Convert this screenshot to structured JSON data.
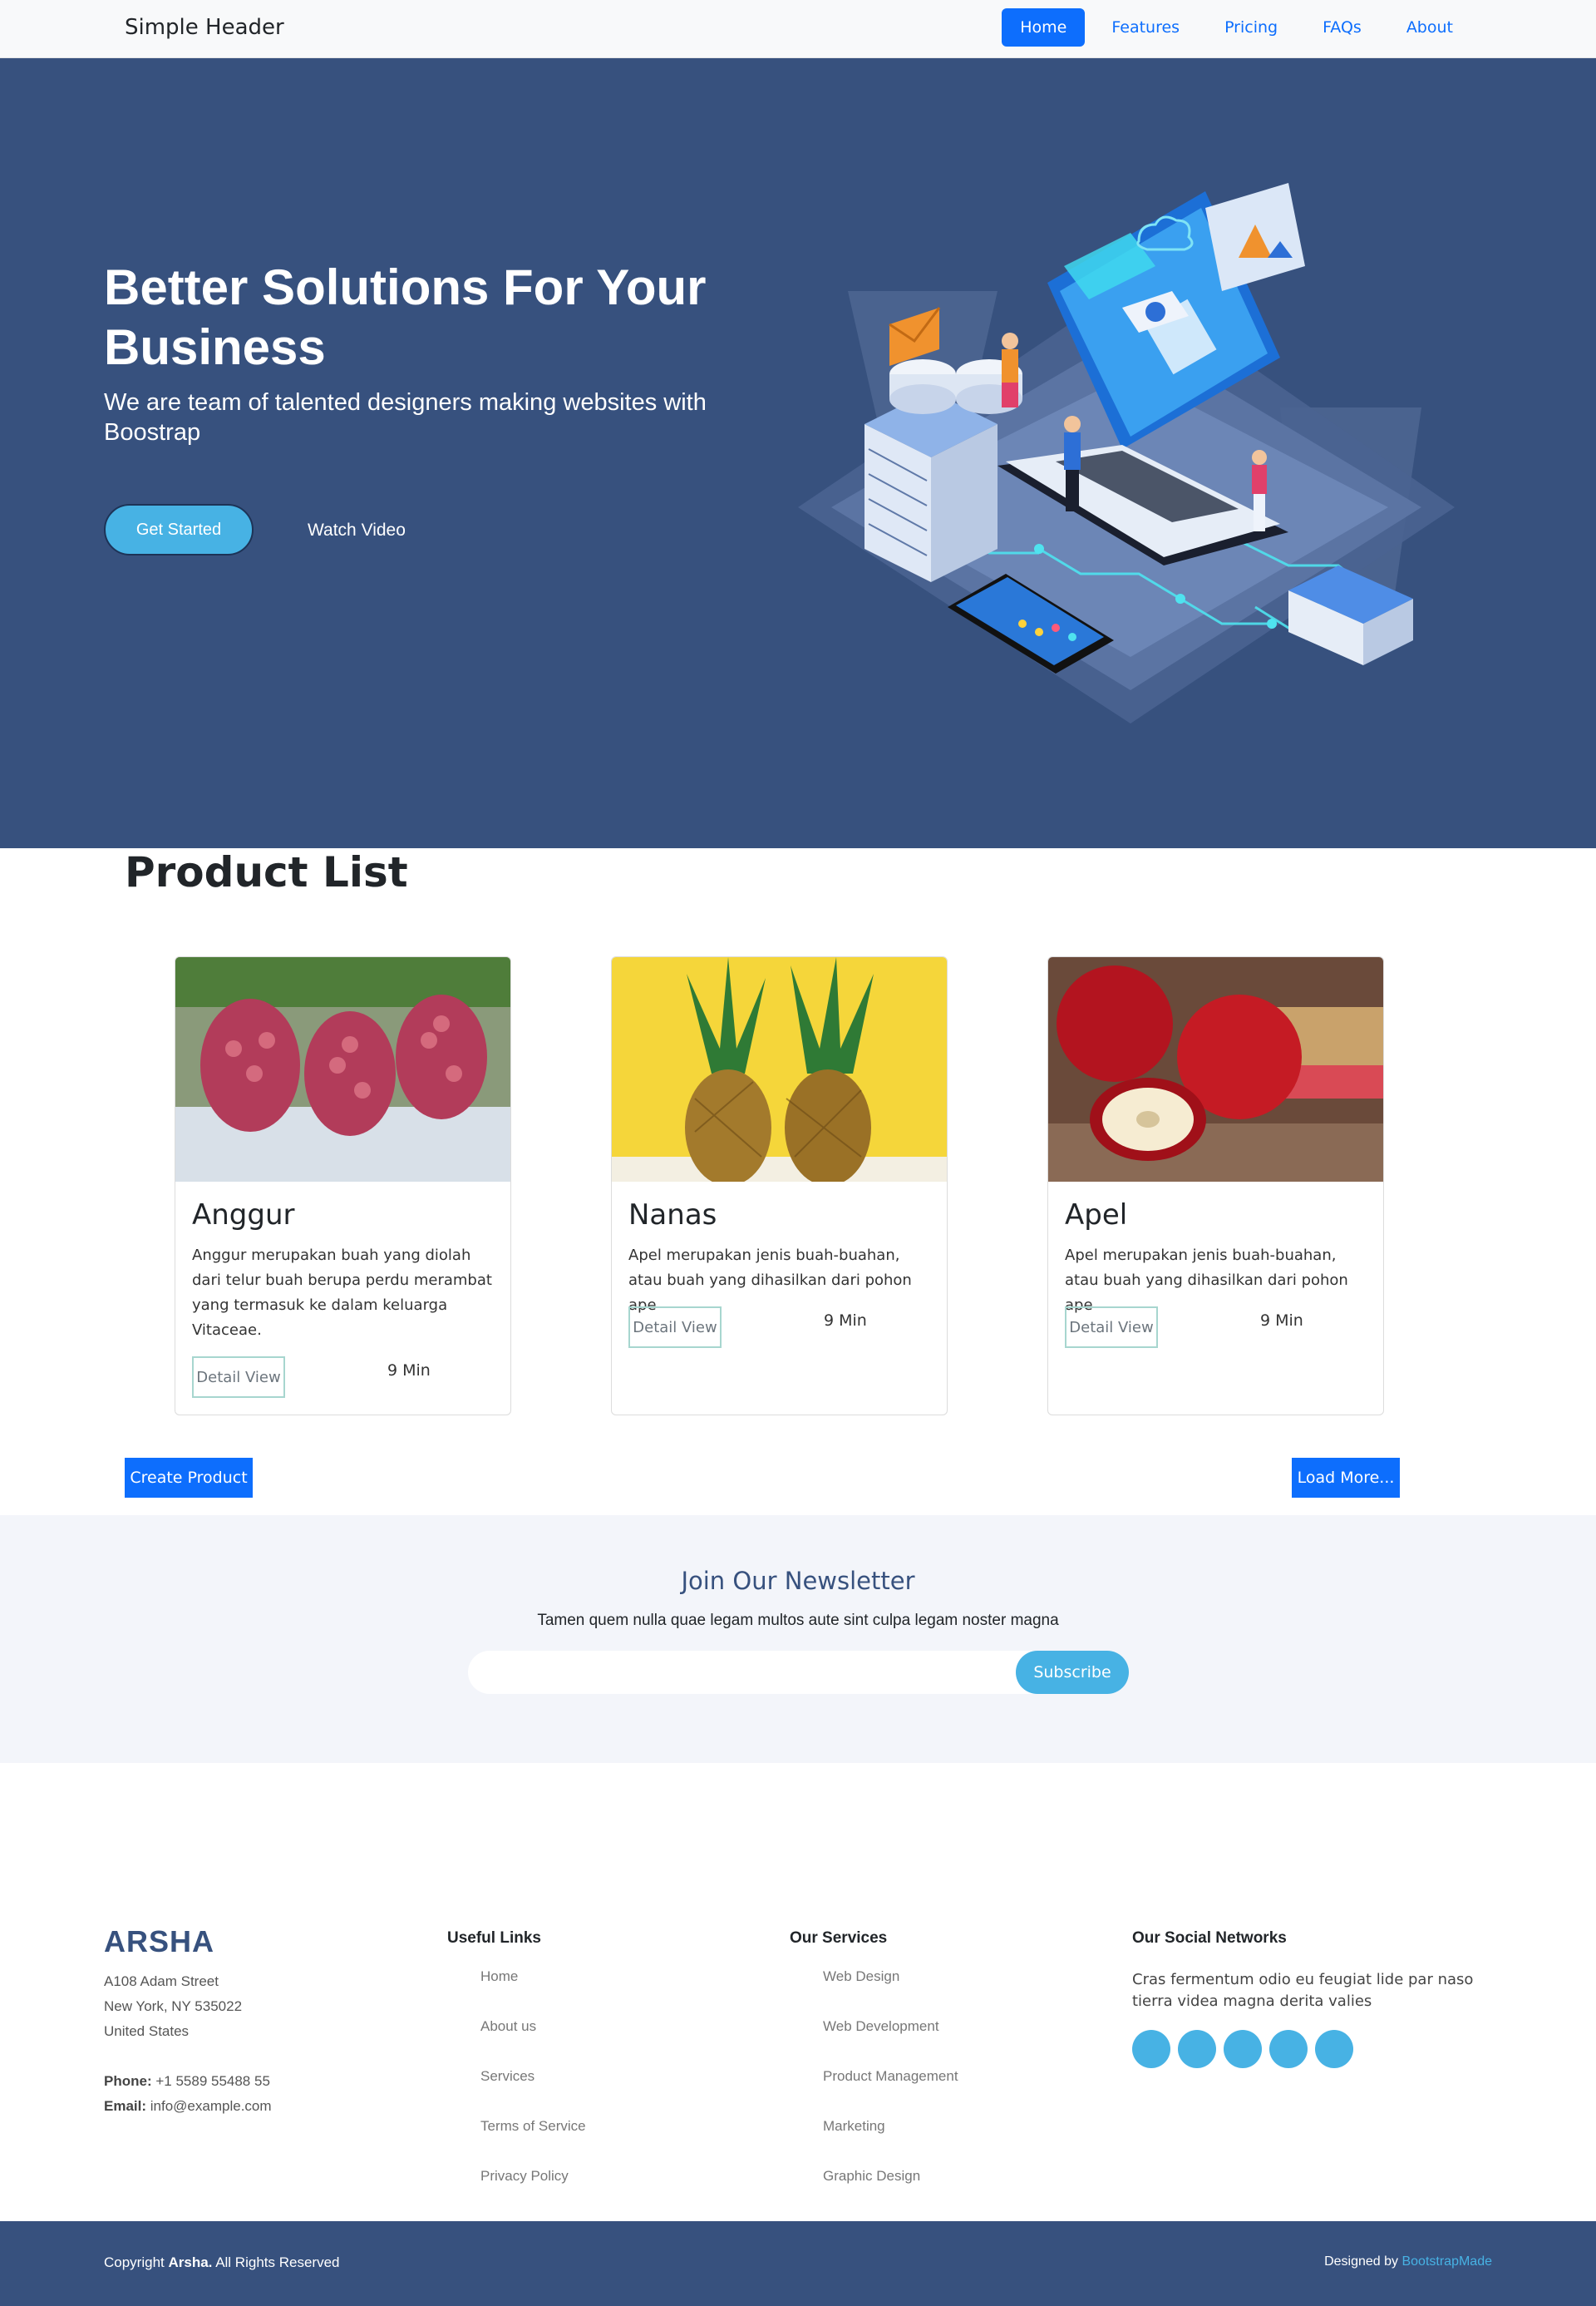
{
  "header": {
    "brand": "Simple Header",
    "nav": [
      {
        "label": "Home",
        "active": true
      },
      {
        "label": "Features",
        "active": false
      },
      {
        "label": "Pricing",
        "active": false
      },
      {
        "label": "FAQs",
        "active": false
      },
      {
        "label": "About",
        "active": false
      }
    ]
  },
  "hero": {
    "title": "Better Solutions For Your Business",
    "subtitle": "We are team of talented designers making websites with Boostrap",
    "cta_primary": "Get Started",
    "cta_secondary": "Watch Video",
    "illustration": "isometric-laptop-illustration"
  },
  "products": {
    "title": "Product List",
    "items": [
      {
        "name": "Anggur",
        "description": "Anggur merupakan buah yang diolah dari telur buah berupa perdu merambat yang termasuk ke dalam keluarga Vitaceae.",
        "button": "Detail View",
        "time": "9 Min",
        "image": "grapes-photo"
      },
      {
        "name": "Nanas",
        "description": "Apel merupakan jenis buah-buahan, atau buah yang dihasilkan dari pohon ape",
        "button": "Detail View",
        "time": "9 Min",
        "image": "pineapple-photo"
      },
      {
        "name": "Apel",
        "description": "Apel merupakan jenis buah-buahan, atau buah yang dihasilkan dari pohon ape",
        "button": "Detail View",
        "time": "9 Min",
        "image": "apple-photo"
      }
    ],
    "create_label": "Create Product",
    "load_label": "Load More..."
  },
  "newsletter": {
    "title": "Join Our Newsletter",
    "text": "Tamen quem nulla quae legam multos aute sint culpa legam noster magna",
    "input_value": "",
    "button": "Subscribe"
  },
  "footer": {
    "logo": "ARSHA",
    "address": [
      "A108 Adam Street",
      "New York, NY 535022",
      "United States"
    ],
    "phone_label": "Phone:",
    "phone": "+1 5589 55488 55",
    "email_label": "Email:",
    "email": "info@example.com",
    "useful_links_title": "Useful Links",
    "useful_links": [
      "Home",
      "About us",
      "Services",
      "Terms of Service",
      "Privacy Policy"
    ],
    "services_title": "Our Services",
    "services": [
      "Web Design",
      "Web Development",
      "Product Management",
      "Marketing",
      "Graphic Design"
    ],
    "social_title": "Our Social Networks",
    "social_text": "Cras fermentum odio eu feugiat lide par naso tierra videa magna derita valies",
    "social_icons": [
      "twitter-icon",
      "facebook-icon",
      "instagram-icon",
      "skype-icon",
      "linkedin-icon"
    ],
    "copyright_prefix": "Copyright ",
    "copyright_brand": "Arsha.",
    "copyright_suffix": " All Rights Reserved",
    "designed_prefix": "Designed by ",
    "designed_link": "BootstrapMade"
  },
  "colors": {
    "hero_bg": "#37517e",
    "accent": "#47b2e4",
    "primary": "#0d6efd",
    "newsletter_bg": "#f3f5fa"
  }
}
